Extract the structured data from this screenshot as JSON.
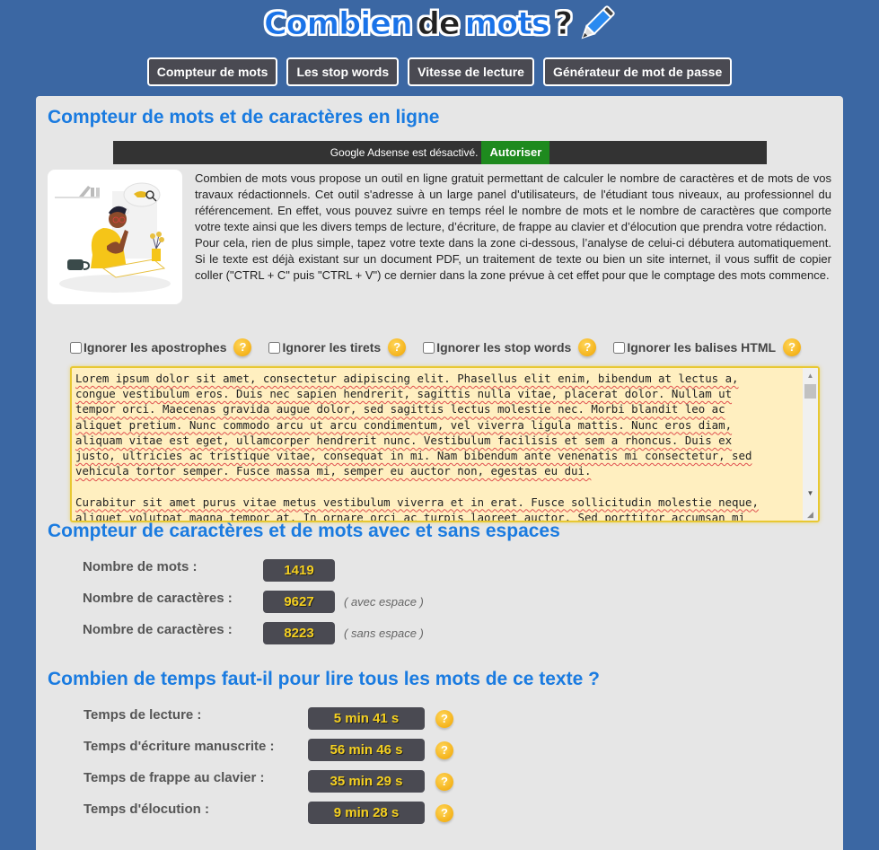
{
  "header": {
    "logo_words": [
      "Combien",
      "de",
      "mots",
      "?"
    ],
    "logo_icon": "pencil-icon"
  },
  "nav": [
    {
      "label": "Compteur de mots"
    },
    {
      "label": "Les stop words"
    },
    {
      "label": "Vitesse de lecture"
    },
    {
      "label": "Générateur de mot de passe"
    }
  ],
  "main": {
    "title": "Compteur de mots et de caractères en ligne",
    "adsense": {
      "message": "Google Adsense est désactivé.",
      "button": "Autoriser"
    },
    "illustration": "person-thinking-illustration",
    "intro": [
      "Combien de mots vous propose un outil en ligne gratuit permettant de calculer le nombre de caractères et de mots de vos travaux rédactionnels. Cet outil s'adresse à un large panel d'utilisateurs, de l'étudiant tous niveaux, au professionnel du référencement. En effet, vous pouvez suivre en temps réel le nombre de mots et le nombre de caractères que comporte votre texte ainsi que les divers temps de lecture, d’écriture, de frappe au clavier et d’élocution que prendra votre rédaction.",
      "Pour cela, rien de plus simple, tapez votre texte dans la zone ci-dessous, l’analyse de celui-ci débutera automatiquement. Si le texte est déjà existant sur un document PDF, un traitement de texte ou bien un site internet, il vous suffit de copier coller (\"CTRL + C\" puis \"CTRL + V\") ce dernier dans la zone prévue à cet effet pour que le comptage des mots commence."
    ],
    "options": [
      {
        "label": "Ignorer les apostrophes",
        "checked": false
      },
      {
        "label": "Ignorer les tirets",
        "checked": false
      },
      {
        "label": "Ignorer les stop words",
        "checked": false
      },
      {
        "label": "Ignorer les balises HTML",
        "checked": false
      }
    ],
    "help_glyph": "?",
    "textarea_value": "Lorem ipsum dolor sit amet, consectetur adipiscing elit. Phasellus elit enim, bibendum at lectus a,\ncongue vestibulum eros. Duis nec sapien hendrerit, sagittis nulla vitae, placerat dolor. Nullam ut\ntempor orci. Maecenas gravida augue dolor, sed sagittis lectus molestie nec. Morbi blandit leo ac\naliquet pretium. Nunc commodo arcu ut arcu condimentum, vel viverra ligula mattis. Nunc eros diam,\naliquam vitae est eget, ullamcorper hendrerit nunc. Vestibulum facilisis et sem a rhoncus. Duis ex\njusto, ultricies ac tristique vitae, consequat in mi. Nam bibendum ante venenatis mi consectetur, sed\nvehicula tortor semper. Fusce massa mi, semper eu auctor non, egestas eu dui.\n\nCurabitur sit amet purus vitae metus vestibulum viverra et in erat. Fusce sollicitudin molestie neque,\naliquet volutpat magna tempor at. In ornare orci ac turpis laoreet auctor. Sed porttitor accumsan mi"
  },
  "counts": {
    "title": "Compteur de caractères et de mots avec et sans espaces",
    "rows": [
      {
        "label": "Nombre de mots :",
        "value": "1419",
        "note": ""
      },
      {
        "label": "Nombre de caractères :",
        "value": "9627",
        "note": "( avec espace )"
      },
      {
        "label": "Nombre de caractères :",
        "value": "8223",
        "note": "( sans espace )"
      }
    ]
  },
  "times": {
    "title": "Combien de temps faut-il pour lire tous les mots de ce texte ?",
    "rows": [
      {
        "label": "Temps de lecture :",
        "value": "5 min 41 s"
      },
      {
        "label": "Temps d'écriture manuscrite :",
        "value": "56 min 46 s"
      },
      {
        "label": "Temps de frappe au clavier :",
        "value": "35 min 29 s"
      },
      {
        "label": "Temps d'élocution :",
        "value": "9 min 28 s"
      }
    ]
  },
  "colors": {
    "background": "#3b67a3",
    "heading": "#1a7be0",
    "value_text": "#f5d020",
    "value_bg": "#4a4a52",
    "textarea_bg": "#ffefc0",
    "adsense_button": "#1e8a1e"
  }
}
